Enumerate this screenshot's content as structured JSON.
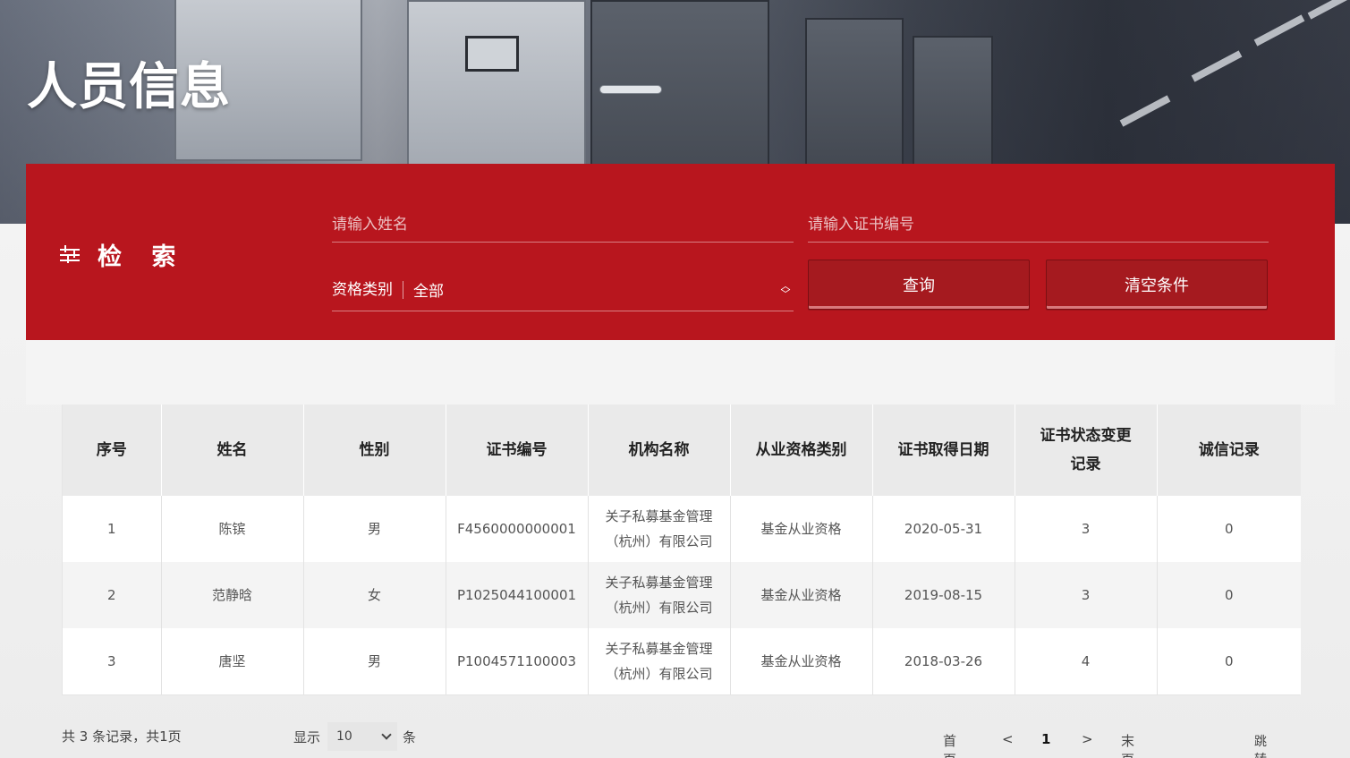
{
  "page": {
    "title": "人员信息"
  },
  "search": {
    "heading": "检 索",
    "name_placeholder": "请输入姓名",
    "cert_placeholder": "请输入证书编号",
    "category_label": "资格类别",
    "category_value": "全部",
    "query_button": "查询",
    "clear_button": "清空条件"
  },
  "table": {
    "headers": [
      "序号",
      "姓名",
      "性别",
      "证书编号",
      "机构名称",
      "从业资格类别",
      "证书取得日期",
      "证书状态变更记录",
      "诚信记录"
    ],
    "rows": [
      [
        "1",
        "陈镔",
        "男",
        "F4560000000001",
        "关子私募基金管理（杭州）有限公司",
        "基金从业资格",
        "2020-05-31",
        "3",
        "0"
      ],
      [
        "2",
        "范静晗",
        "女",
        "P1025044100001",
        "关子私募基金管理（杭州）有限公司",
        "基金从业资格",
        "2019-08-15",
        "3",
        "0"
      ],
      [
        "3",
        "唐坚",
        "男",
        "P1004571100003",
        "关子私募基金管理（杭州）有限公司",
        "基金从业资格",
        "2018-03-26",
        "4",
        "0"
      ]
    ]
  },
  "pagination": {
    "summary": "共 3 条记录，共1页",
    "show_label": "显示",
    "page_size": "10",
    "unit": "条",
    "first": "首页",
    "prev": "<",
    "current": "1",
    "next": ">",
    "last": "末页",
    "go": "跳转"
  },
  "colors": {
    "panel_red": "#b8161e",
    "button_red": "#a51a1f",
    "header_gray": "#eaeaea"
  }
}
